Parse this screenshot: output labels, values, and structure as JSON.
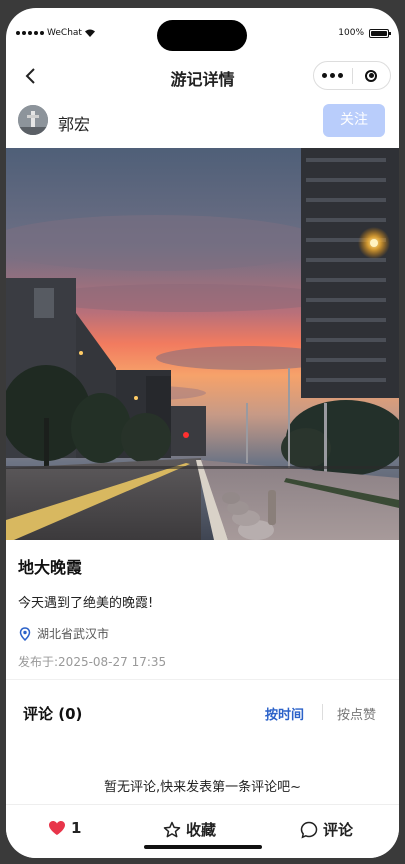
{
  "status_bar": {
    "carrier": "WeChat",
    "battery": "100%"
  },
  "nav": {
    "title": "游记详情"
  },
  "author": {
    "name": "郭宏",
    "follow_label": "关注"
  },
  "post": {
    "title": "地大晚霞",
    "body": "今天遇到了绝美的晚霞!",
    "location": "湖北省武汉市",
    "published_label": "发布于:",
    "published_at": "2025-08-27 17:35"
  },
  "comments": {
    "title": "评论",
    "count": "(0)",
    "sort_time": "按时间",
    "sort_likes": "按点赞",
    "empty_text": "暂无评论,快来发表第一条评论吧~"
  },
  "bottom_bar": {
    "like_count": "1",
    "favorite_label": "收藏",
    "comment_label": "评论"
  },
  "colors": {
    "accent": "#2c62c9",
    "follow_bg": "#b9cdfb",
    "like": "#e8354a"
  }
}
